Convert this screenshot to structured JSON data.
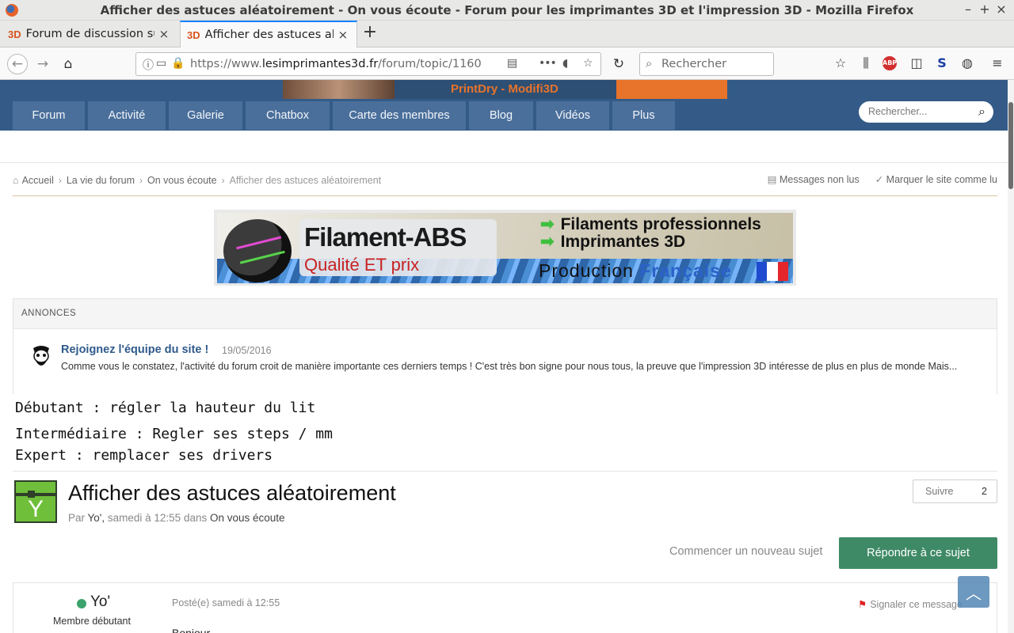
{
  "window": {
    "title": "Afficher des astuces aléatoirement - On vous écoute - Forum pour les imprimantes 3D et l'impression 3D - Mozilla Firefox",
    "controls": [
      "–",
      "+",
      "×"
    ]
  },
  "tabs": [
    {
      "favicon": "3D",
      "label": "Forum de discussion sur",
      "close": "×",
      "active": false
    },
    {
      "favicon": "3D",
      "label": "Afficher des astuces aléa",
      "close": "×",
      "active": true
    }
  ],
  "newtab": "+",
  "navbar": {
    "url_prefix": "https://www.",
    "url_domain": "lesimprimantes3d.fr",
    "url_path": "/forum/topic/1160",
    "search_placeholder": "Rechercher",
    "more": "•••"
  },
  "site": {
    "banner_text": "PrintDry - Modifi3D",
    "nav": [
      "Forum",
      "Activité",
      "Galerie",
      "Chatbox",
      "Carte des membres",
      "Blog",
      "Vidéos",
      "Plus"
    ],
    "search_placeholder": "Rechercher..."
  },
  "breadcrumbs": {
    "items": [
      "Accueil",
      "La vie du forum",
      "On vous écoute",
      "Afficher des astuces aléatoirement"
    ],
    "unread": "Messages non lus",
    "mark_read": "Marquer le site comme lu"
  },
  "ad": {
    "title": "Filament-ABS",
    "subtitle": "Qualité ET prix",
    "line1": "Filaments professionnels",
    "line2": "Imprimantes 3D",
    "line3a": "Production ",
    "line3b": "Française"
  },
  "annonces": {
    "header": "ANNONCES",
    "title": "Rejoignez l'équipe du site !",
    "date": "19/05/2016",
    "text": "Comme vous le constatez, l'activité du forum croit de manière importante ces derniers temps ! C'est très bon signe pour nous tous, la preuve que l'impression 3D intéresse de plus en plus de monde Mais..."
  },
  "tips": [
    "Débutant : régler la hauteur du lit",
    "Intermédiaire : Regler ses steps / mm",
    "Expert : remplacer ses drivers"
  ],
  "topic": {
    "title": "Afficher des astuces aléatoirement",
    "by": "Par ",
    "author": "Yo',",
    "when": " samedi à 12:55 dans ",
    "forum": "On vous écoute",
    "follow_label": "Suivre",
    "follow_count": "2",
    "new_topic": "Commencer un nouveau sujet",
    "reply": "Répondre à ce sujet"
  },
  "post": {
    "author": "Yo'",
    "rank": "Membre débutant",
    "posted": "Posté(e) samedi à 12:55",
    "report": "Signaler ce message",
    "body": "Bonjour"
  },
  "colors": {
    "site_blue": "#345b87",
    "reply_green": "#3f8a66",
    "link_blue": "#2f5a8b",
    "online": "#3aa36b"
  }
}
